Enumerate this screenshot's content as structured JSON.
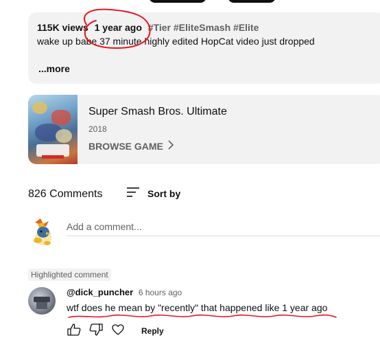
{
  "video": {
    "views": "115K views",
    "age": "1 year ago",
    "hashtags": "#Tier #EliteSmash #Elite",
    "description": "wake up babe 37 minute highly edited HopCat video just dropped",
    "more_label": "...more"
  },
  "game": {
    "title": "Super Smash Bros. Ultimate",
    "year": "2018",
    "browse_label": "BROWSE GAME"
  },
  "comments": {
    "count": "826 Comments",
    "sort_label": "Sort by",
    "add_placeholder": "Add a comment...",
    "highlighted_label": "Highlighted comment",
    "items": [
      {
        "author": "@dick_puncher",
        "time": "6 hours ago",
        "text": "wtf does he mean by \"recently\" that happened like 1 year ago",
        "reply_label": "Reply"
      }
    ]
  },
  "annotation_color": "#e8141e"
}
